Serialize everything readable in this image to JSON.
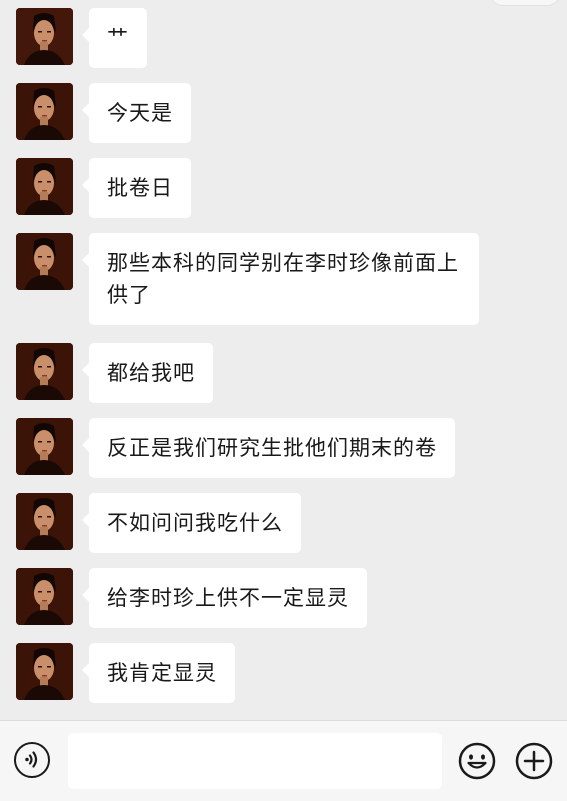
{
  "messages": [
    {
      "text": "艹"
    },
    {
      "text": "今天是"
    },
    {
      "text": "批卷日"
    },
    {
      "text": "那些本科的同学别在李时珍像前面上供了"
    },
    {
      "text": "都给我吧"
    },
    {
      "text": "反正是我们研究生批他们期末的卷"
    },
    {
      "text": "不如问问我吃什么"
    },
    {
      "text": "给李时珍上供不一定显灵"
    },
    {
      "text": "我肯定显灵"
    }
  ],
  "input": {
    "placeholder": "",
    "value": ""
  },
  "icons": {
    "voice": "voice-icon",
    "emoji": "emoji-icon",
    "plus": "plus-icon",
    "avatar": "avatar-portrait"
  },
  "colors": {
    "background": "#ededed",
    "bubble": "#ffffff",
    "text": "#191919",
    "input_bar": "#f6f6f6"
  }
}
